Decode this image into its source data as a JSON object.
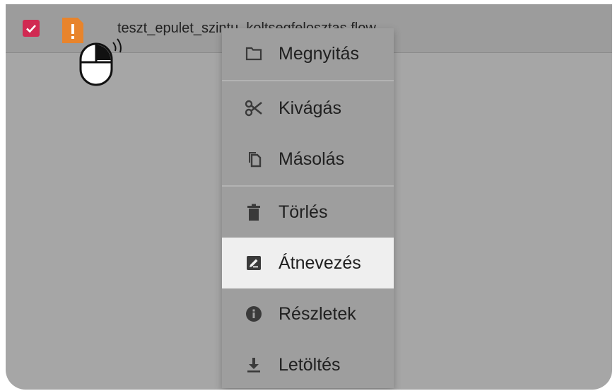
{
  "file": {
    "name": "teszt_epulet_szintu_koltsegfelosztas.flow",
    "checkbox_color": "#d12a52",
    "file_icon_color": "#e8842c",
    "icon": "warning-file-icon"
  },
  "context_menu": {
    "items": [
      {
        "label": "Megnyitás",
        "icon": "folder-icon"
      },
      {
        "label": "Kivágás",
        "icon": "scissors-icon"
      },
      {
        "label": "Másolás",
        "icon": "copy-icon"
      },
      {
        "label": "Törlés",
        "icon": "trash-icon"
      },
      {
        "label": "Átnevezés",
        "icon": "rename-icon",
        "highlighted": true
      },
      {
        "label": "Részletek",
        "icon": "info-icon"
      },
      {
        "label": "Letöltés",
        "icon": "download-icon"
      }
    ]
  },
  "colors": {
    "overlay": "#a6a6a6",
    "highlight": "#efefef"
  }
}
